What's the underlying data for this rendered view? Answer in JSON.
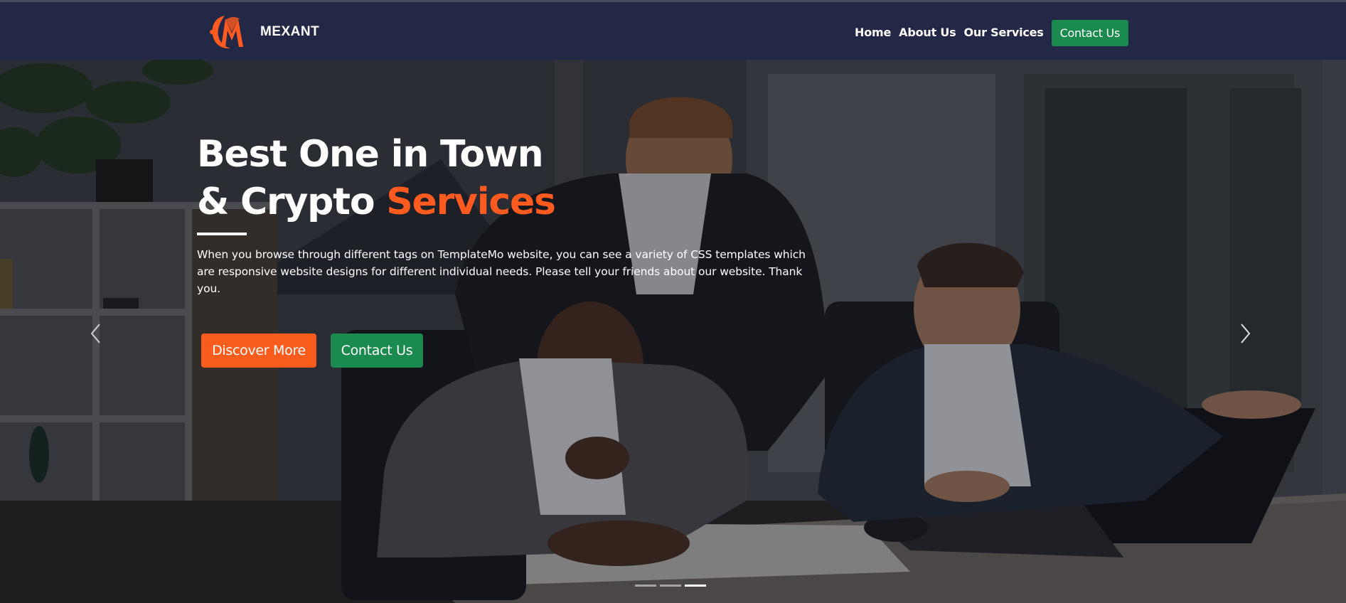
{
  "brand": {
    "name": "MEXANT",
    "logo_icon": "mexant-logo-icon",
    "accent": "#ff5a1f"
  },
  "nav": {
    "links": [
      "Home",
      "About Us",
      "Our Services"
    ],
    "contact_label": "Contact Us",
    "contact_color": "#1a8a4e",
    "background": "#232846"
  },
  "hero": {
    "title_line1": "Best One in Town",
    "title_line2_prefix": "& Crypto ",
    "title_line2_accent": "Services",
    "description": "When you browse through different tags on TemplateMo website, you can see a variety of CSS templates which are responsive website designs for different individual needs. Please tell your friends about our website. Thank you.",
    "discover_label": "Discover More",
    "discover_color": "#fa5c1e",
    "contact_label": "Contact Us",
    "contact_color": "#1a8a4e",
    "prev_icon": "chevron-left-icon",
    "next_icon": "chevron-right-icon",
    "slide_count": 3,
    "active_slide": 3
  }
}
